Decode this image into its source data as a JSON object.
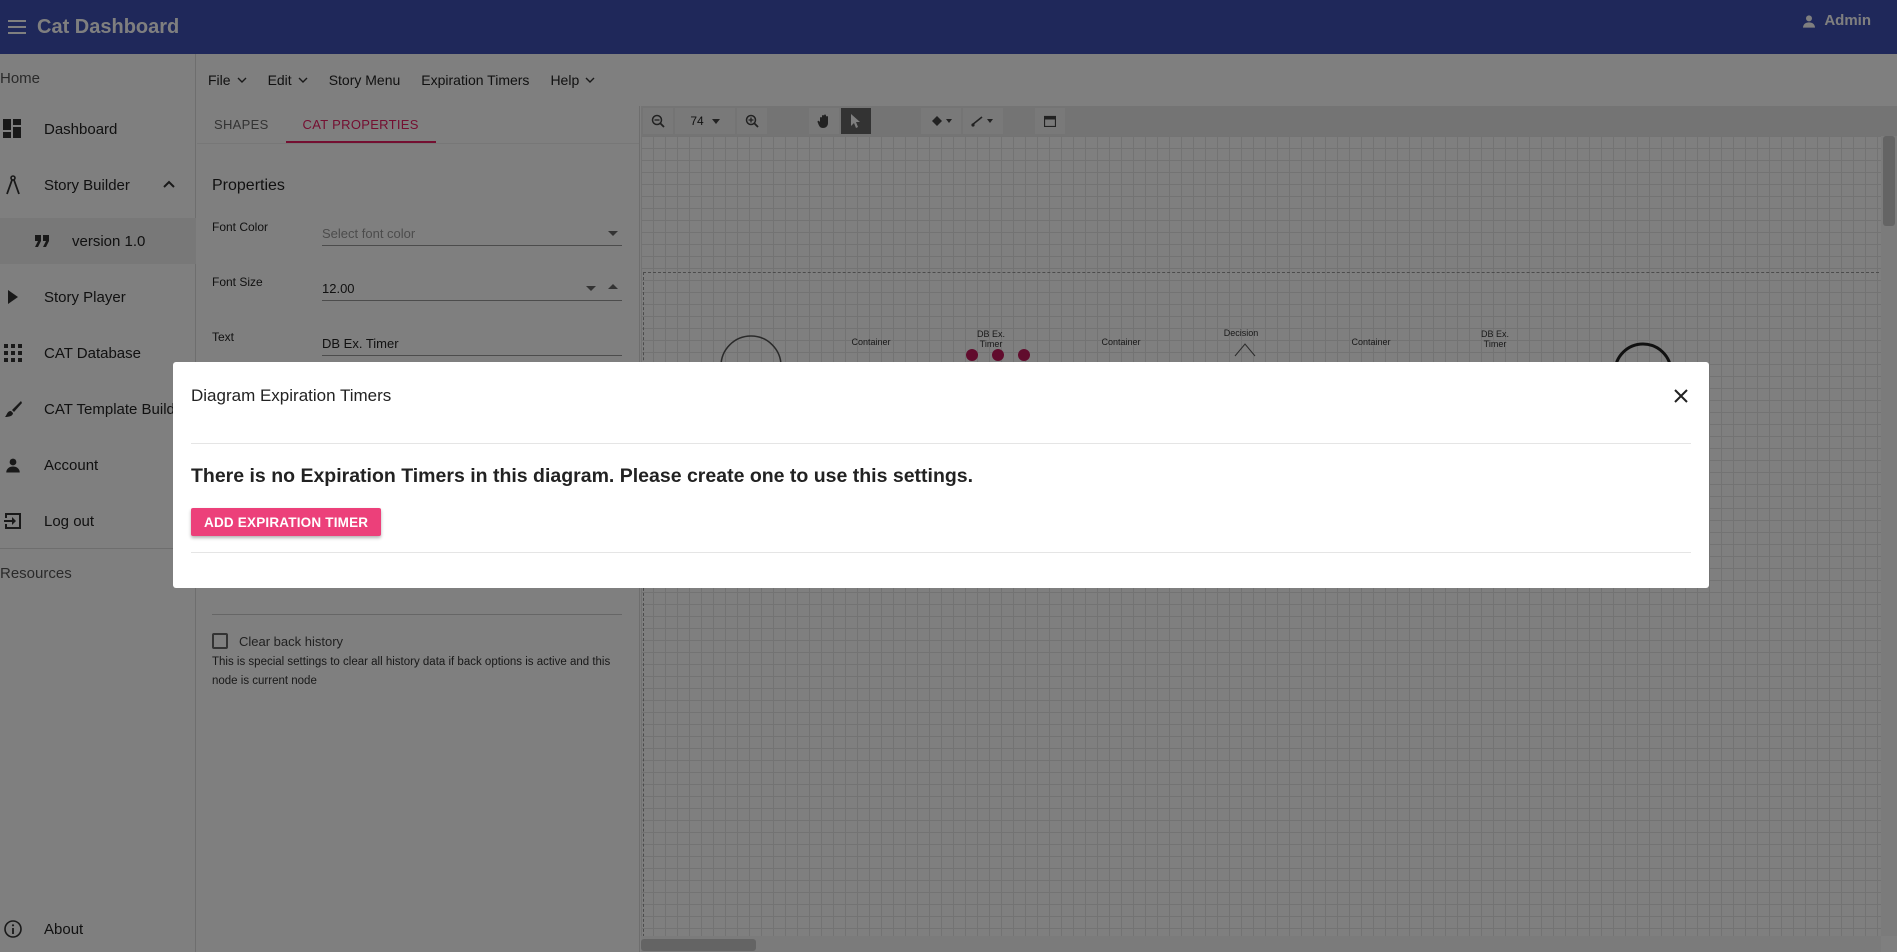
{
  "app": {
    "title": "Cat Dashboard",
    "user": "Admin"
  },
  "sidebar": {
    "home": "Home",
    "items": [
      {
        "label": "Dashboard",
        "icon": "dashboard-icon"
      },
      {
        "label": "Story Builder",
        "icon": "compass-icon"
      },
      {
        "label": "version 1.0",
        "icon": "quote-icon"
      },
      {
        "label": "Story Player",
        "icon": "play-icon"
      },
      {
        "label": "CAT Database",
        "icon": "grid-icon"
      },
      {
        "label": "CAT Template Builder",
        "icon": "brush-icon"
      },
      {
        "label": "Account",
        "icon": "person-icon"
      },
      {
        "label": "Log out",
        "icon": "logout-icon"
      }
    ],
    "resources": "Resources",
    "about": "About"
  },
  "menubar": {
    "file": "File",
    "edit": "Edit",
    "story_menu": "Story Menu",
    "expiration_timers": "Expiration Timers",
    "help": "Help"
  },
  "panel": {
    "tabs": [
      "SHAPES",
      "CAT PROPERTIES"
    ],
    "heading": "Properties",
    "font_color_label": "Font Color",
    "font_color_placeholder": "Select font color",
    "font_size_label": "Font Size",
    "font_size_value": "12.00",
    "text_label": "Text",
    "text_value": "DB Ex. Timer",
    "clear_history_label": "Clear back history",
    "clear_history_help": "This is special settings to clear all history data if back options is active and this node is current node"
  },
  "toolbar": {
    "zoom": "74"
  },
  "diagram": {
    "nodes": [
      "Container",
      "DB Ex. Timer",
      "Container",
      "Decision",
      "Container",
      "DB Ex. Timer"
    ]
  },
  "modal": {
    "title": "Diagram Expiration Timers",
    "message": "There is no Expiration Timers in this diagram. Please create one to use this settings.",
    "button": "ADD EXPIRATION TIMER"
  },
  "colors": {
    "topbar": "#3f51b5",
    "accent": "#e91e63",
    "button": "#ec407a"
  }
}
